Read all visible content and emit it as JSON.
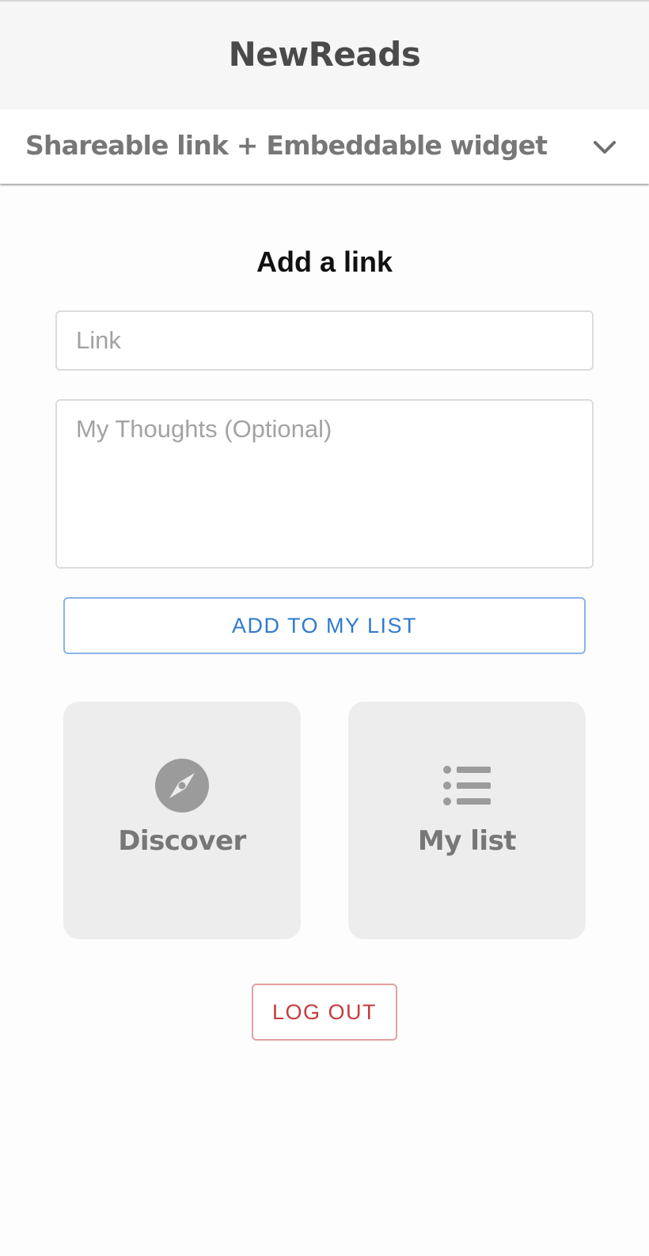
{
  "header": {
    "title": "NewReads"
  },
  "share_panel": {
    "label": "Shareable link + Embeddable widget",
    "icon": "chevron-down-icon"
  },
  "form": {
    "title": "Add a link",
    "link_placeholder": "Link",
    "link_value": "",
    "thoughts_placeholder": "My Thoughts (Optional)",
    "thoughts_value": "",
    "submit_label": "ADD TO MY LIST"
  },
  "nav_tiles": [
    {
      "label": "Discover",
      "icon": "compass-icon"
    },
    {
      "label": "My list",
      "icon": "list-icon"
    }
  ],
  "logout": {
    "label": "LOG OUT"
  },
  "colors": {
    "accent_blue": "#2f7ad0",
    "danger_red": "#c43c3c",
    "tile_bg": "#ededed",
    "icon_gray": "#9b9b9b",
    "header_bg": "#f6f6f6"
  }
}
